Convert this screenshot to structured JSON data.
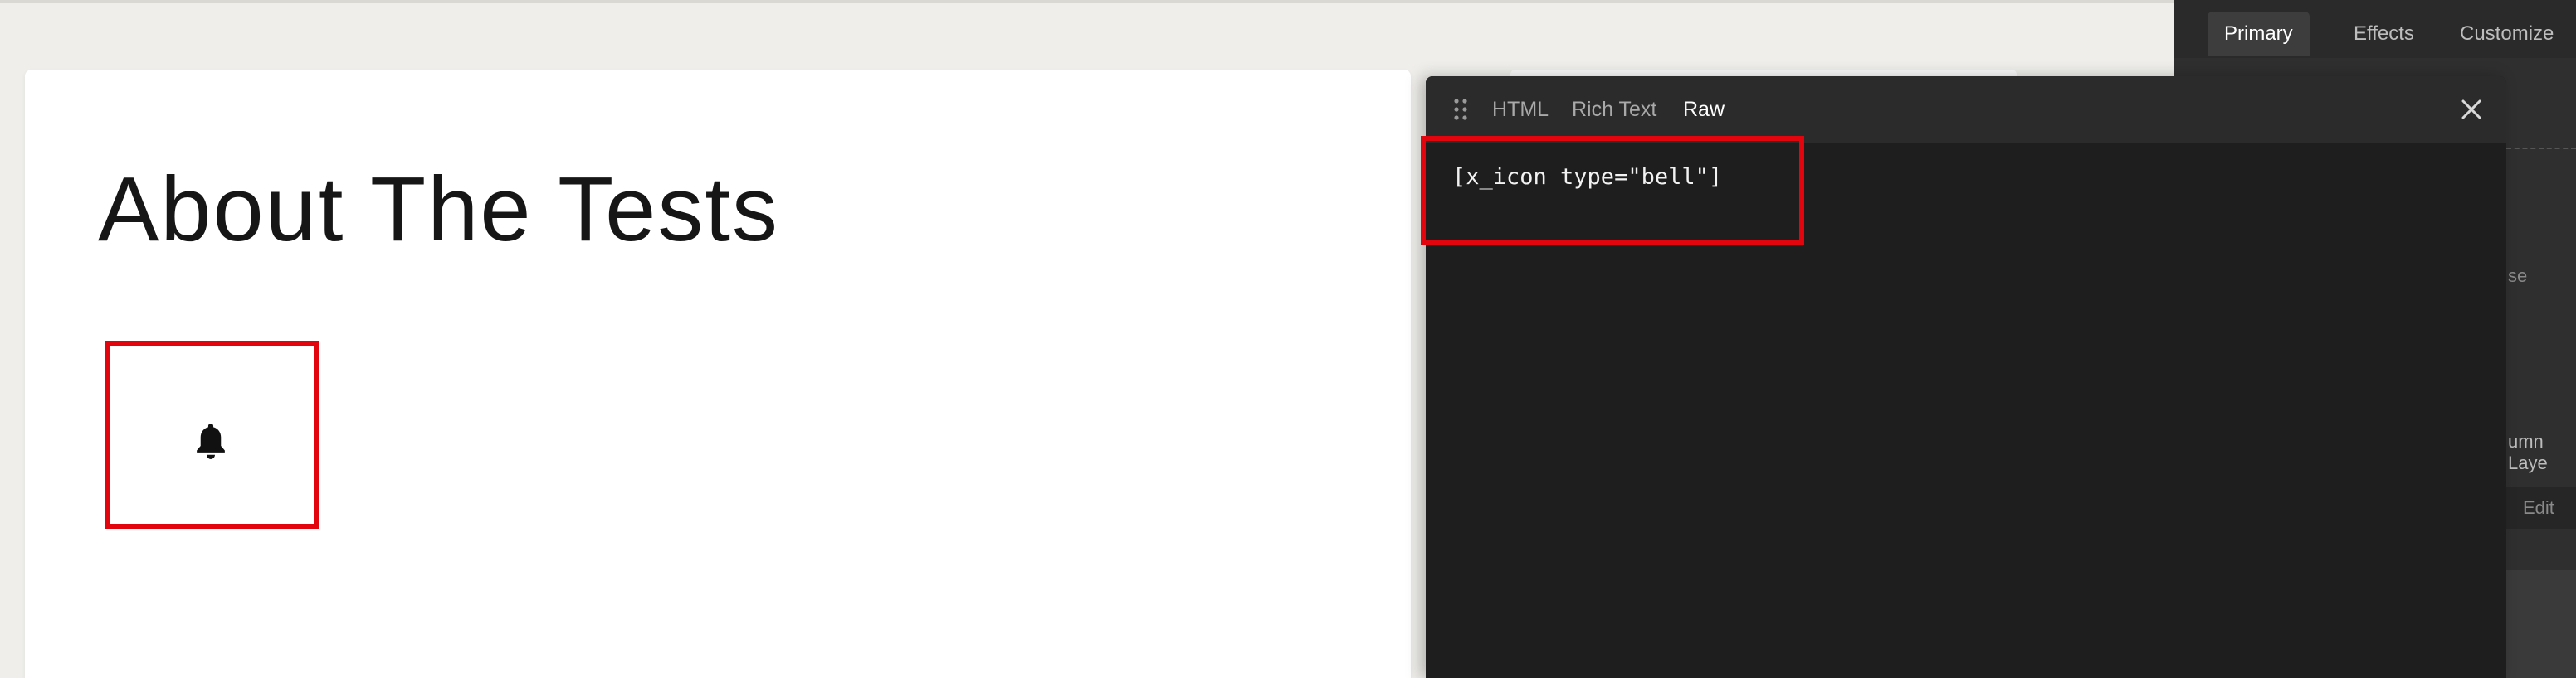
{
  "canvas": {
    "title": "About The Tests",
    "icon_name": "bell-icon"
  },
  "editor": {
    "tabs": [
      {
        "label": "HTML",
        "active": false
      },
      {
        "label": "Rich Text",
        "active": false
      },
      {
        "label": "Raw",
        "active": true
      }
    ],
    "code": "[x_icon type=\"bell\"]"
  },
  "right_panel": {
    "tabs": [
      {
        "label": "Primary",
        "active": true
      },
      {
        "label": "Effects",
        "active": false
      },
      {
        "label": "Customize",
        "active": false
      }
    ],
    "partial_texts": {
      "text_1": "se",
      "text_2": "umn Laye",
      "text_3": "Edit"
    }
  },
  "colors": {
    "highlight": "#e3050d",
    "editor_bg": "#1e1e1e",
    "page_bg": "#efeeea"
  }
}
